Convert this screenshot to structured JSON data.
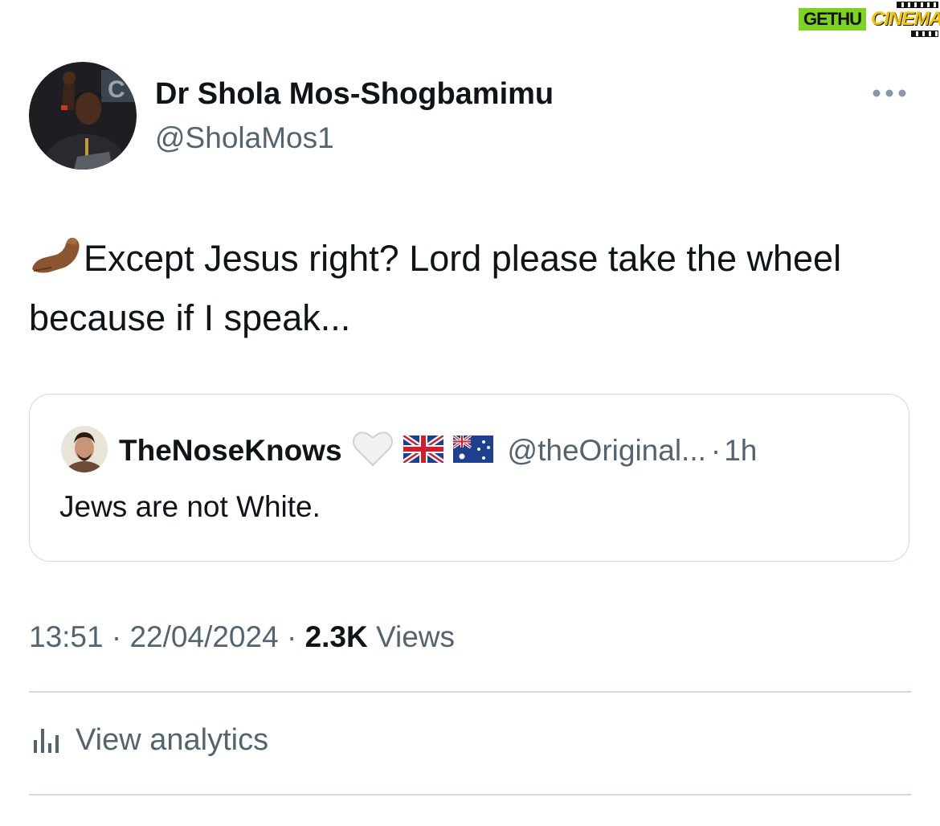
{
  "watermark": {
    "left": "GETHU",
    "right": "CINEMA"
  },
  "tweet": {
    "author_name": "Dr Shola Mos-Shogbamimu",
    "author_handle": "@SholaMos1",
    "text": "Except Jesus right? Lord please take the wheel because if I speak...",
    "leading_emoji": "pinched-fingers-icon"
  },
  "quote": {
    "author_name": "TheNoseKnows",
    "badges": [
      "white-heart-icon",
      "uk-flag-icon",
      "australia-flag-icon"
    ],
    "author_handle": "@theOriginal...",
    "separator": "·",
    "time": "1h",
    "text": "Jews are not White."
  },
  "meta": {
    "time": "13:51",
    "sep1": "·",
    "date": "22/04/2024",
    "sep2": "·",
    "views_count": "2.3K",
    "views_label": "Views"
  },
  "actions": {
    "analytics_label": "View analytics"
  },
  "colors": {
    "primary_text": "#0f1419",
    "secondary_text": "#536471",
    "border": "#cfd9de"
  }
}
